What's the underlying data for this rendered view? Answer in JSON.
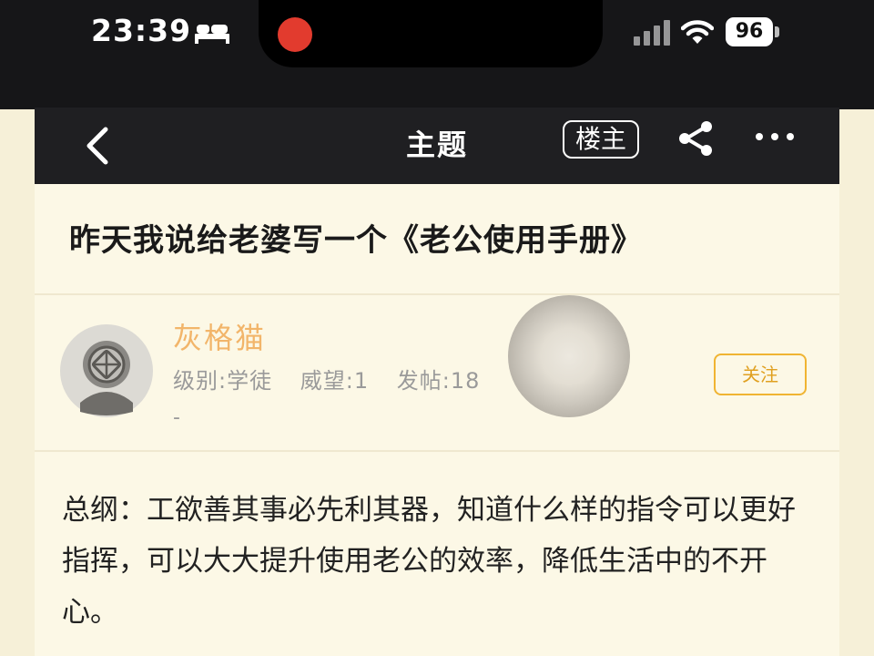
{
  "status_bar": {
    "time": "23:39",
    "battery": "96"
  },
  "nav": {
    "title": "主题",
    "op_badge": "楼主"
  },
  "post": {
    "title": "昨天我说给老婆写一个《老公使用手册》",
    "author": {
      "name": "灰格猫",
      "level": "级别:学徒",
      "prestige": "威望:1",
      "posts": "发帖:18",
      "extra": "-",
      "follow_label": "关注"
    },
    "body": "总纲：工欲善其事必先利其器，知道什么样的指令可以更好指挥，可以大大提升使用老公的效率，降低生活中的不开心。"
  }
}
